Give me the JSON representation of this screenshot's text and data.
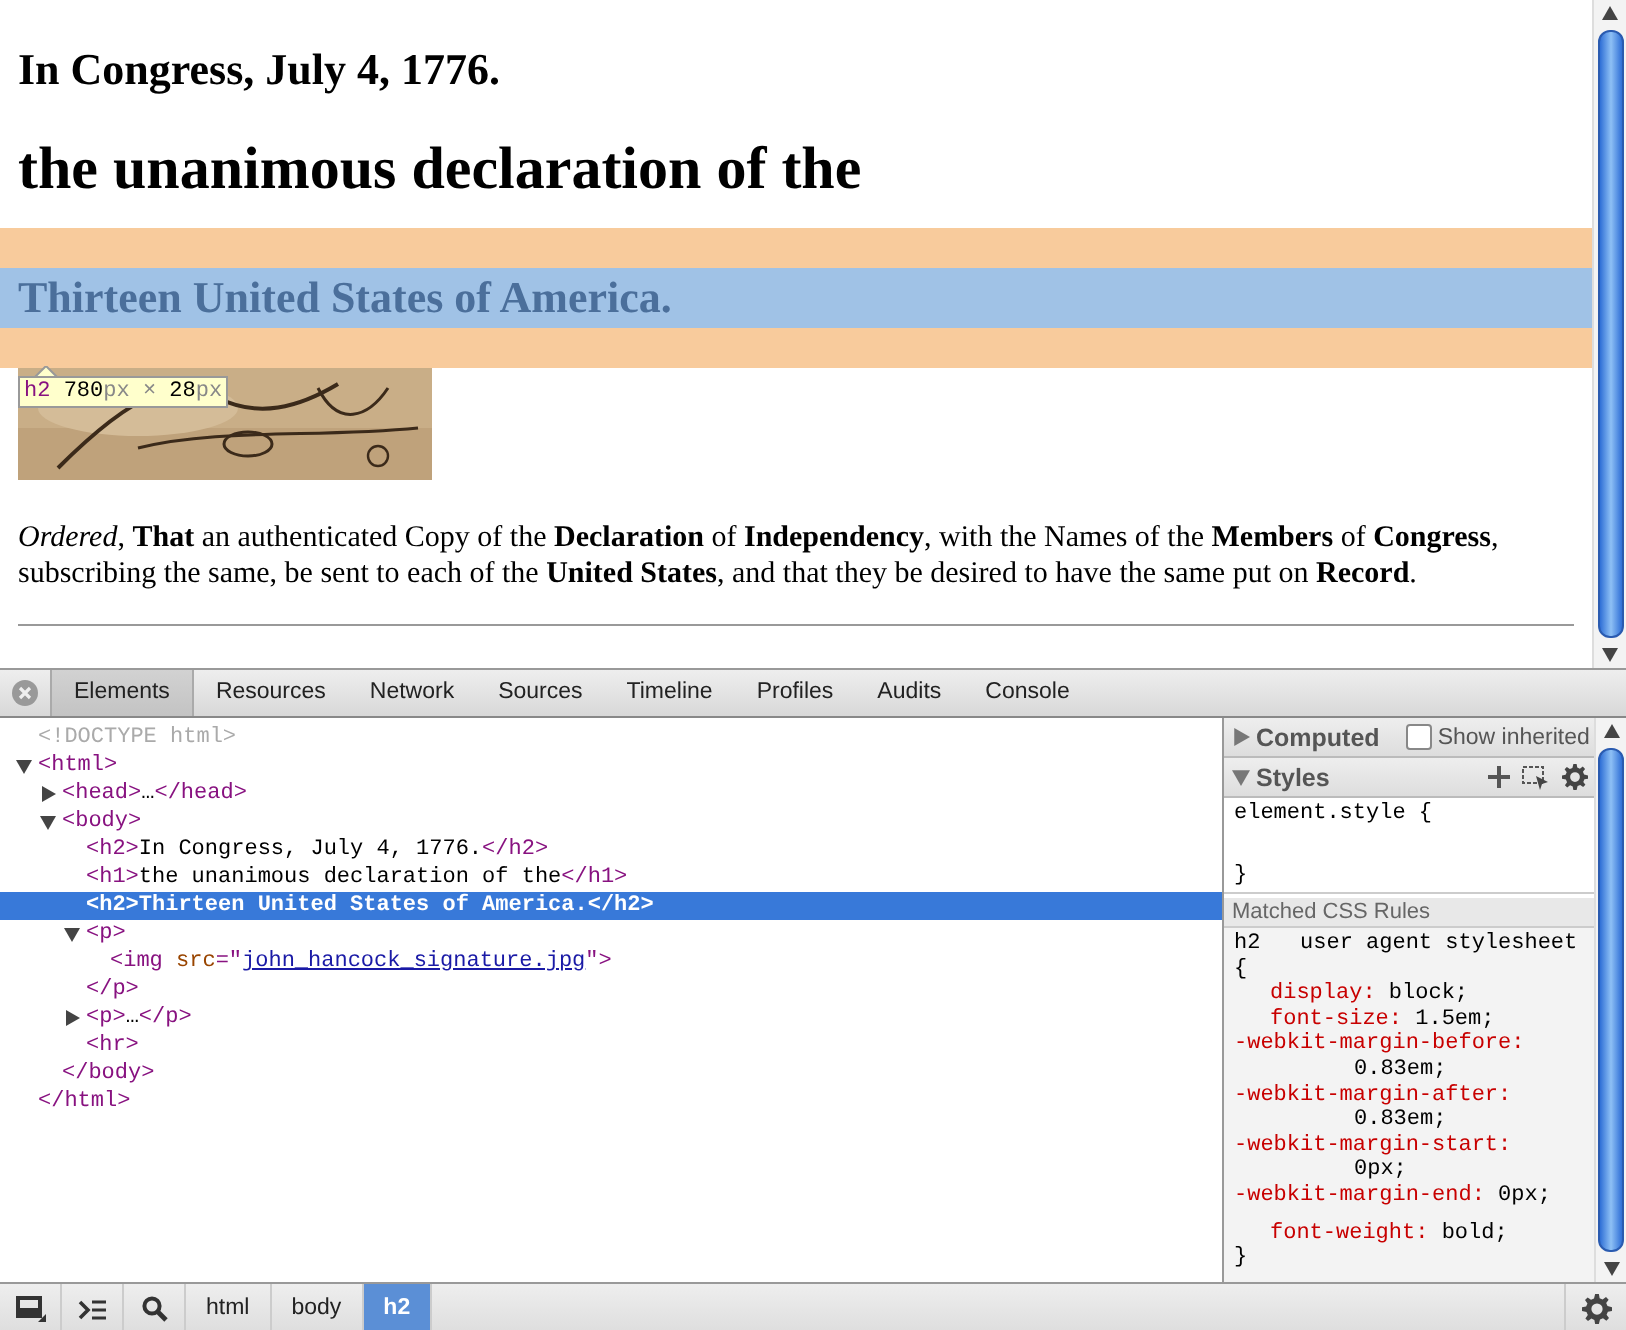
{
  "page": {
    "headings": [
      {
        "kind": "subheading",
        "text": "In Congress, July 4, 1776.",
        "highlighted": false
      },
      {
        "kind": "heading",
        "text": "the unanimous declaration of the",
        "highlighted": false
      },
      {
        "kind": "subheading",
        "text": "Thirteen United States of America.",
        "highlighted": true
      }
    ],
    "tooltip": [
      {
        "kind": "tag",
        "text": "h2"
      },
      {
        "kind": "number",
        "text": "780"
      },
      {
        "kind": "unit",
        "text": "px"
      },
      {
        "kind": "unit",
        "text": "×"
      },
      {
        "kind": "number",
        "text": "28"
      },
      {
        "kind": "unit",
        "text": "px"
      }
    ],
    "paragraph": "*Ordered*, **That** an authenticated Copy of the **Declaration** of **Independency**, with the Names of the **Members** of **Congress**, subscribing the same, be sent to each of the **United States**, and that they be desired to have the same put on **Record**."
  },
  "devtools": {
    "tabs": [
      {
        "label": "Elements",
        "selected": true
      },
      {
        "label": "Resources",
        "selected": false
      },
      {
        "label": "Network",
        "selected": false
      },
      {
        "label": "Sources",
        "selected": false
      },
      {
        "label": "Timeline",
        "selected": false
      },
      {
        "label": "Profiles",
        "selected": false
      },
      {
        "label": "Audits",
        "selected": false
      },
      {
        "label": "Console",
        "selected": false
      }
    ],
    "dom_tree": [
      {
        "parts": [
          {
            "kind": "doctype",
            "text": "<!DOCTYPE html>"
          }
        ],
        "selected": false
      },
      {
        "parts": [
          {
            "kind": "tag",
            "text": "<html>"
          }
        ],
        "expanded": true,
        "selected": false,
        "children": [
          {
            "parts": [
              {
                "kind": "tag",
                "text": "<head>"
              },
              {
                "kind": "text",
                "text": "…"
              },
              {
                "kind": "tag",
                "text": "</head>"
              }
            ],
            "expanded": false,
            "selected": false
          },
          {
            "parts": [
              {
                "kind": "tag",
                "text": "<body>"
              }
            ],
            "expanded": true,
            "selected": false,
            "children": [
              {
                "parts": [
                  {
                    "kind": "tag",
                    "text": "<h2>"
                  },
                  {
                    "kind": "text",
                    "text": "In Congress, July 4, 1776."
                  },
                  {
                    "kind": "tag",
                    "text": "</h2>"
                  }
                ],
                "selected": false
              },
              {
                "parts": [
                  {
                    "kind": "tag",
                    "text": "<h1>"
                  },
                  {
                    "kind": "text",
                    "text": "the unanimous declaration of the"
                  },
                  {
                    "kind": "tag",
                    "text": "</h1>"
                  }
                ],
                "selected": false
              },
              {
                "parts": [
                  {
                    "kind": "tag",
                    "text": "<h2>"
                  },
                  {
                    "kind": "text",
                    "text": "Thirteen United States of America."
                  },
                  {
                    "kind": "tag",
                    "text": "</h2>"
                  }
                ],
                "selected": true
              },
              {
                "parts": [
                  {
                    "kind": "tag",
                    "text": "<p>"
                  }
                ],
                "expanded": true,
                "selected": false,
                "children": [
                  {
                    "parts": [
                      {
                        "kind": "tag",
                        "text": "<img"
                      },
                      {
                        "kind": "attr",
                        "text": " src"
                      },
                      {
                        "kind": "tag",
                        "text": "=\""
                      },
                      {
                        "kind": "link",
                        "text": "john_hancock_signature.jpg"
                      },
                      {
                        "kind": "tag",
                        "text": "\">"
                      }
                    ],
                    "selected": false
                  }
                ],
                "close": [
                  {
                    "kind": "tag",
                    "text": "</p>"
                  }
                ]
              },
              {
                "parts": [
                  {
                    "kind": "tag",
                    "text": "<p>"
                  },
                  {
                    "kind": "text",
                    "text": "…"
                  },
                  {
                    "kind": "tag",
                    "text": "</p>"
                  }
                ],
                "expanded": false,
                "selected": false
              },
              {
                "parts": [
                  {
                    "kind": "tag",
                    "text": "<hr>"
                  }
                ],
                "selected": false
              }
            ],
            "close": [
              {
                "kind": "tag",
                "text": "</body>"
              }
            ]
          }
        ],
        "close": [
          {
            "kind": "tag",
            "text": "</html>"
          }
        ]
      }
    ],
    "sidebar": {
      "computed": {
        "title": "Computed",
        "expanded": false,
        "show_inherited": {
          "label": "Show inherited",
          "checked": false
        }
      },
      "styles": {
        "title": "Styles",
        "expanded": true,
        "element_style": {
          "selector": "element.style {",
          "close": "}"
        },
        "matched_header": "Matched CSS Rules",
        "rules": [
          {
            "selector": "h2",
            "source": "user agent stylesheet",
            "open": "{",
            "close": "}",
            "declarations": [
              {
                "kind": "standard",
                "property": "display:",
                "value": "block;",
                "wrap": false
              },
              {
                "kind": "standard",
                "property": "font-size:",
                "value": "1.5em;",
                "wrap": false
              },
              {
                "kind": "vendor",
                "property": "-webkit-margin-before:",
                "value": "0.83em;",
                "wrap": true
              },
              {
                "kind": "vendor",
                "property": "-webkit-margin-after:",
                "value": "0.83em;",
                "wrap": true
              },
              {
                "kind": "vendor",
                "property": "-webkit-margin-start:",
                "value": "0px;",
                "wrap": true
              },
              {
                "kind": "vendor",
                "property": "-webkit-margin-end:",
                "value": "0px;",
                "wrap": false
              },
              {
                "kind": "standard",
                "property": "font-weight:",
                "value": "bold;",
                "wrap": false
              }
            ]
          }
        ]
      }
    },
    "breadcrumbs": [
      {
        "label": "html",
        "selected": false
      },
      {
        "label": "body",
        "selected": false
      },
      {
        "label": "h2",
        "selected": true
      }
    ]
  }
}
